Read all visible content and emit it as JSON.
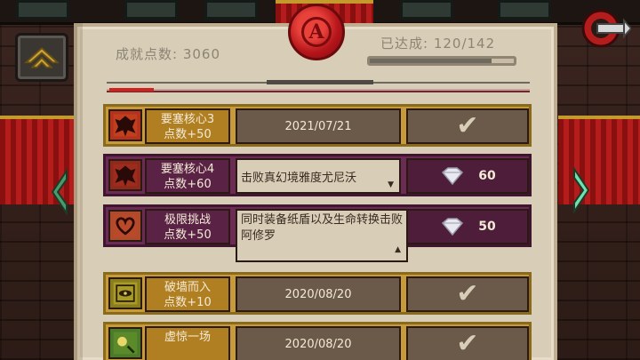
{
  "header": {
    "score_label": "成就点数: 3060",
    "achieved_label": "已达成: 120/142",
    "achieved_progress": 0.845,
    "seal_letter": "A"
  },
  "achievements": [
    {
      "name_line1": "要塞核心3",
      "name_line2": "点数+50",
      "detail": "2021/07/21",
      "reward": "",
      "status": "completed",
      "style": "gold",
      "icon": "fortress-eagle-icon"
    },
    {
      "name_line1": "要塞核心4",
      "name_line2": "点数+60",
      "detail": "击败真幻境雅度尤尼沃",
      "reward": "60",
      "status": "locked",
      "style": "purple",
      "icon": "fortress-eagle-icon"
    },
    {
      "name_line1": "极限挑战",
      "name_line2": "点数+50",
      "detail": "同时装备纸盾以及生命转换击败阿修罗",
      "reward": "50",
      "status": "locked",
      "style": "purple",
      "icon": "ornate-heart-icon"
    },
    {
      "name_line1": "破墙而入",
      "name_line2": "点数+10",
      "detail": "2020/08/20",
      "reward": "",
      "status": "completed",
      "style": "gold",
      "icon": "eye-wall-icon"
    },
    {
      "name_line1": "虚惊一场",
      "name_line2": "",
      "detail": "2020/08/20",
      "reward": "",
      "status": "completed",
      "style": "gold",
      "icon": "surprise-icon"
    }
  ],
  "colors": {
    "gold_row": "#c79b3a",
    "purple_row": "#6b2b54",
    "paper": "#d8cdb7",
    "seal_red": "#b5151a",
    "nav_arrow": "#5fd3a0"
  }
}
